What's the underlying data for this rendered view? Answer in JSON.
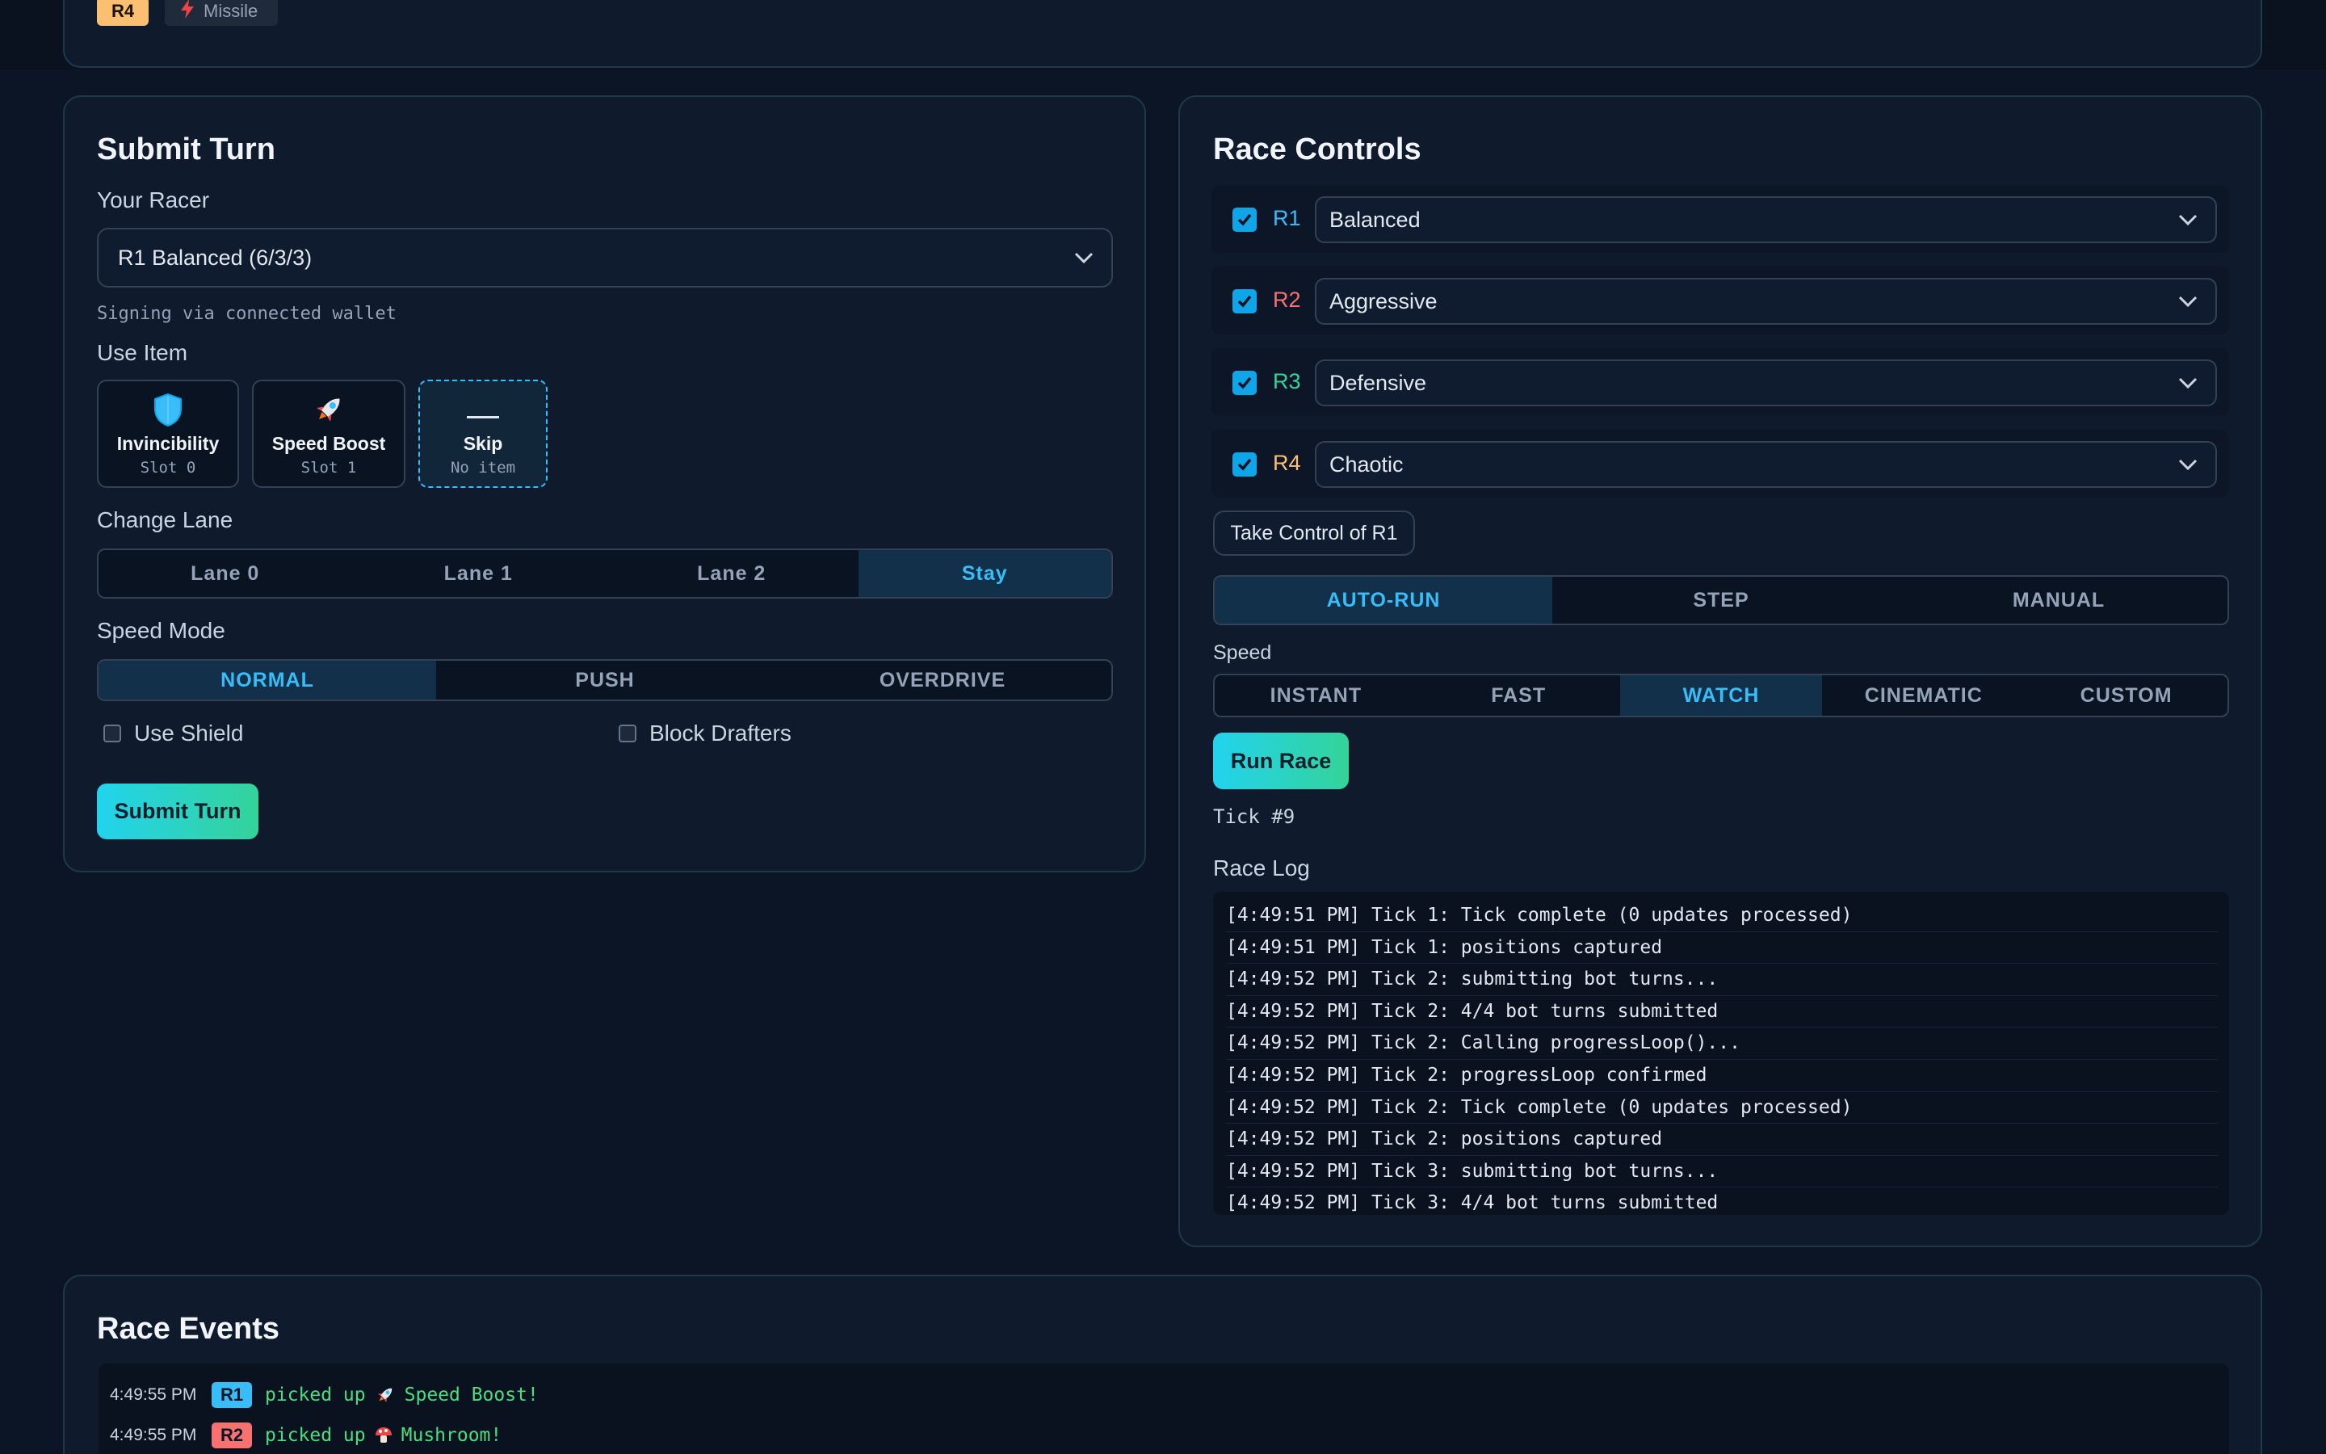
{
  "top": {
    "badge": "R4",
    "item_label": "Missile"
  },
  "submit_turn": {
    "title": "Submit Turn",
    "racer_label": "Your Racer",
    "racer_value": "R1 Balanced (6/3/3)",
    "signing_hint": "Signing via connected wallet",
    "use_item_label": "Use Item",
    "items": [
      {
        "name": "Invincibility",
        "sub": "Slot 0",
        "icon": "shield-icon"
      },
      {
        "name": "Speed Boost",
        "sub": "Slot 1",
        "icon": "rocket-icon"
      },
      {
        "name": "Skip",
        "sub": "No item",
        "icon": "dash-icon",
        "selected": true
      }
    ],
    "lane_label": "Change Lane",
    "lanes": [
      "Lane 0",
      "Lane 1",
      "Lane 2",
      "Stay"
    ],
    "lane_selected": "Stay",
    "speed_mode_label": "Speed Mode",
    "speed_modes": [
      "NORMAL",
      "PUSH",
      "OVERDRIVE"
    ],
    "speed_mode_selected": "NORMAL",
    "use_shield_label": "Use Shield",
    "use_shield": false,
    "block_drafters_label": "Block Drafters",
    "block_drafters": false,
    "submit_label": "Submit Turn"
  },
  "race_controls": {
    "title": "Race Controls",
    "racers": [
      {
        "id": "R1",
        "strategy": "Balanced",
        "checked": true,
        "color": "#38bdf8"
      },
      {
        "id": "R2",
        "strategy": "Aggressive",
        "checked": true,
        "color": "#f87171"
      },
      {
        "id": "R3",
        "strategy": "Defensive",
        "checked": true,
        "color": "#34d399"
      },
      {
        "id": "R4",
        "strategy": "Chaotic",
        "checked": true,
        "color": "#fbbf72"
      }
    ],
    "take_control_label": "Take Control of R1",
    "run_modes": [
      "AUTO-RUN",
      "STEP",
      "MANUAL"
    ],
    "run_mode_selected": "AUTO-RUN",
    "speed_label": "Speed",
    "speeds": [
      "INSTANT",
      "FAST",
      "WATCH",
      "CINEMATIC",
      "CUSTOM"
    ],
    "speed_selected": "WATCH",
    "run_label": "Run Race",
    "tick": "Tick #9",
    "log_label": "Race Log",
    "log": [
      "[4:49:51 PM] Tick 1: Tick complete (0 updates processed)",
      "[4:49:51 PM] Tick 1: positions captured",
      "[4:49:52 PM] Tick 2: submitting bot turns...",
      "[4:49:52 PM] Tick 2: 4/4 bot turns submitted",
      "[4:49:52 PM] Tick 2: Calling progressLoop()...",
      "[4:49:52 PM] Tick 2: progressLoop confirmed",
      "[4:49:52 PM] Tick 2: Tick complete (0 updates processed)",
      "[4:49:52 PM] Tick 2: positions captured",
      "[4:49:52 PM] Tick 3: submitting bot turns...",
      "[4:49:52 PM] Tick 3: 4/4 bot turns submitted"
    ]
  },
  "race_events": {
    "title": "Race Events",
    "events": [
      {
        "time": "4:49:55 PM",
        "racer": "R1",
        "racer_color": "#38bdf8",
        "text_before": "picked up",
        "icon": "rocket-icon",
        "text_after": "Speed Boost!"
      },
      {
        "time": "4:49:55 PM",
        "racer": "R2",
        "racer_color": "#f87171",
        "text_before": "picked up",
        "icon": "mushroom-icon",
        "text_after": "Mushroom!"
      }
    ]
  },
  "colors": {
    "background": "#0c1526",
    "card": "#0f1a2d",
    "accent": "#38bdf8",
    "event_text": "#4ade80"
  }
}
